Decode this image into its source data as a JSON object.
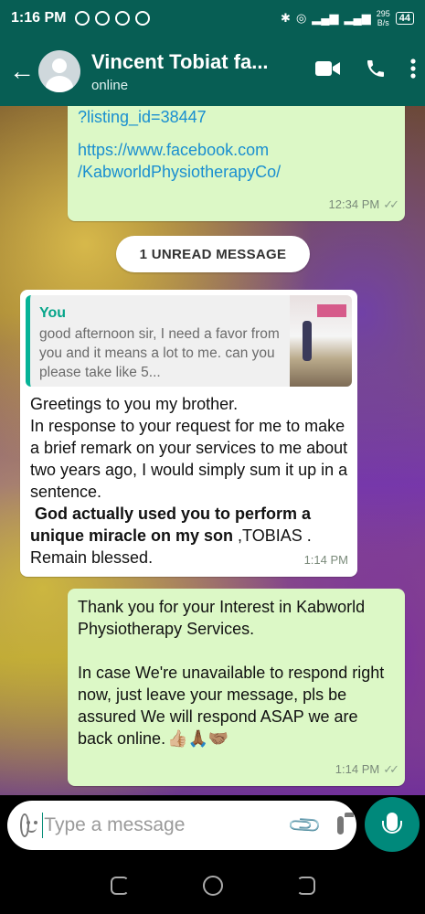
{
  "status_bar": {
    "time": "1:16 PM",
    "net_speed_value": "295",
    "net_speed_unit": "B/s",
    "battery": "44"
  },
  "header": {
    "contact_name": "Vincent Tobiat fa...",
    "contact_status": "online"
  },
  "messages": {
    "m1": {
      "text_part": "?listing_id=38447",
      "link": "https://www.facebook.com\n/KabworldPhysiotherapyCo/",
      "time": "12:34 PM",
      "ticks": "✓✓"
    },
    "unread_label": "1 UNREAD MESSAGE",
    "m2": {
      "quote_author": "You",
      "quote_text": "good afternoon sir, I need a favor from you and it means a lot to me. can you please take like 5...",
      "text_intro": "Greetings to you my brother.\nIn response to your request for me to make a brief remark on your services to me about two years ago, I would simply sum it up in a sentence.",
      "text_bold": " God actually used you to perform a unique miracle on my son",
      "text_tail": " ,TOBIAS .\nRemain blessed.",
      "time": "1:14 PM"
    },
    "m3": {
      "text": "Thank you for your Interest in Kabworld Physiotherapy Services.\n\nIn case We're unavailable to respond right now, just leave your message, pls be assured We will respond ASAP we are back online.",
      "emojis": "👍🏼🙏🏾🤝🏽",
      "time": "1:14 PM",
      "ticks": "✓✓"
    }
  },
  "composer": {
    "placeholder": "Type a message"
  },
  "colors": {
    "header": "#075e54",
    "outgoing_bubble": "#dcf8c6",
    "incoming_bubble": "#ffffff",
    "accent": "#00897b",
    "link": "#1a8fd0"
  }
}
